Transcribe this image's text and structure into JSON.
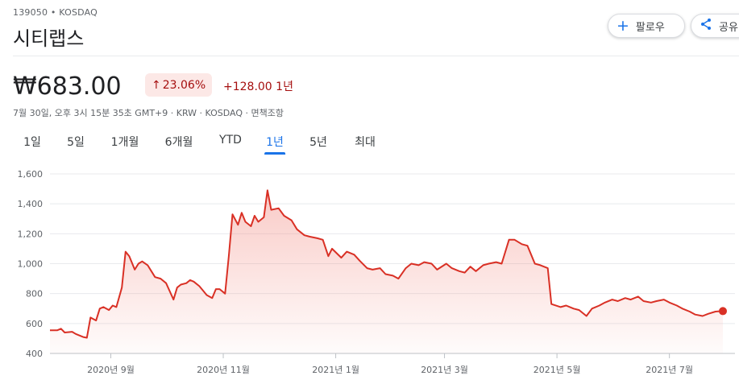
{
  "header": {
    "ticker": "139050 • KOSDAQ",
    "name": "시티랩스",
    "follow_label": "팔로우",
    "share_label": "공유"
  },
  "quote": {
    "price": "₩683.00",
    "change_pct": "23.06%",
    "change_abs": "+128.00 1년",
    "meta": "7월 30일, 오후 3시 15분 35초 GMT+9 · KRW · KOSDAQ · 면책조항"
  },
  "tabs": [
    {
      "label": "1일"
    },
    {
      "label": "5일"
    },
    {
      "label": "1개월"
    },
    {
      "label": "6개월"
    },
    {
      "label": "YTD"
    },
    {
      "label": "1년",
      "active": true
    },
    {
      "label": "5년"
    },
    {
      "label": "최대"
    }
  ],
  "colors": {
    "accent": "#1a73e8",
    "negative_text": "#a50e0e",
    "line": "#d93025",
    "badge_bg": "#fce8e6"
  },
  "icons": {
    "follow": "plus-icon",
    "share": "share-icon",
    "change": "arrow-up-icon"
  },
  "chart_data": {
    "type": "area",
    "ylim": [
      400,
      1600
    ],
    "yticks": [
      400,
      600,
      800,
      1000,
      1200,
      1400,
      1600
    ],
    "xticks": [
      "2020년 9월",
      "2020년 11월",
      "2021년 1월",
      "2021년 3월",
      "2021년 5월",
      "2021년 7월"
    ],
    "x_start": "2020-07-30",
    "x_end": "2021-07-30",
    "series": [
      {
        "values": [
          [
            "2020-07-30",
            555
          ],
          [
            "2020-08-03",
            555
          ],
          [
            "2020-08-05",
            565
          ],
          [
            "2020-08-07",
            540
          ],
          [
            "2020-08-11",
            545
          ],
          [
            "2020-08-13",
            530
          ],
          [
            "2020-08-17",
            510
          ],
          [
            "2020-08-19",
            505
          ],
          [
            "2020-08-21",
            640
          ],
          [
            "2020-08-24",
            620
          ],
          [
            "2020-08-26",
            700
          ],
          [
            "2020-08-28",
            710
          ],
          [
            "2020-08-31",
            690
          ],
          [
            "2020-09-02",
            720
          ],
          [
            "2020-09-04",
            710
          ],
          [
            "2020-09-07",
            840
          ],
          [
            "2020-09-09",
            1080
          ],
          [
            "2020-09-11",
            1050
          ],
          [
            "2020-09-14",
            960
          ],
          [
            "2020-09-16",
            1000
          ],
          [
            "2020-09-18",
            1015
          ],
          [
            "2020-09-21",
            990
          ],
          [
            "2020-09-23",
            950
          ],
          [
            "2020-09-25",
            910
          ],
          [
            "2020-09-28",
            900
          ],
          [
            "2020-10-01",
            870
          ],
          [
            "2020-10-05",
            760
          ],
          [
            "2020-10-07",
            840
          ],
          [
            "2020-10-09",
            860
          ],
          [
            "2020-10-12",
            870
          ],
          [
            "2020-10-14",
            890
          ],
          [
            "2020-10-16",
            880
          ],
          [
            "2020-10-19",
            850
          ],
          [
            "2020-10-21",
            820
          ],
          [
            "2020-10-23",
            790
          ],
          [
            "2020-10-26",
            770
          ],
          [
            "2020-10-28",
            830
          ],
          [
            "2020-10-30",
            830
          ],
          [
            "2020-11-02",
            800
          ],
          [
            "2020-11-04",
            1050
          ],
          [
            "2020-11-06",
            1330
          ],
          [
            "2020-11-09",
            1260
          ],
          [
            "2020-11-11",
            1340
          ],
          [
            "2020-11-13",
            1280
          ],
          [
            "2020-11-16",
            1250
          ],
          [
            "2020-11-18",
            1320
          ],
          [
            "2020-11-20",
            1280
          ],
          [
            "2020-11-23",
            1310
          ],
          [
            "2020-11-25",
            1490
          ],
          [
            "2020-11-27",
            1360
          ],
          [
            "2020-12-01",
            1370
          ],
          [
            "2020-12-04",
            1320
          ],
          [
            "2020-12-08",
            1290
          ],
          [
            "2020-12-11",
            1230
          ],
          [
            "2020-12-15",
            1190
          ],
          [
            "2020-12-18",
            1180
          ],
          [
            "2020-12-22",
            1170
          ],
          [
            "2020-12-25",
            1160
          ],
          [
            "2020-12-28",
            1050
          ],
          [
            "2020-12-30",
            1100
          ],
          [
            "2021-01-04",
            1040
          ],
          [
            "2021-01-07",
            1080
          ],
          [
            "2021-01-11",
            1060
          ],
          [
            "2021-01-14",
            1020
          ],
          [
            "2021-01-18",
            970
          ],
          [
            "2021-01-21",
            960
          ],
          [
            "2021-01-25",
            970
          ],
          [
            "2021-01-28",
            930
          ],
          [
            "2021-02-01",
            920
          ],
          [
            "2021-02-04",
            900
          ],
          [
            "2021-02-08",
            970
          ],
          [
            "2021-02-11",
            1000
          ],
          [
            "2021-02-15",
            990
          ],
          [
            "2021-02-18",
            1010
          ],
          [
            "2021-02-22",
            1000
          ],
          [
            "2021-02-25",
            960
          ],
          [
            "2021-03-02",
            1000
          ],
          [
            "2021-03-05",
            970
          ],
          [
            "2021-03-09",
            950
          ],
          [
            "2021-03-12",
            940
          ],
          [
            "2021-03-15",
            980
          ],
          [
            "2021-03-18",
            950
          ],
          [
            "2021-03-22",
            990
          ],
          [
            "2021-03-25",
            1000
          ],
          [
            "2021-03-29",
            1010
          ],
          [
            "2021-04-01",
            1000
          ],
          [
            "2021-04-05",
            1160
          ],
          [
            "2021-04-08",
            1160
          ],
          [
            "2021-04-12",
            1130
          ],
          [
            "2021-04-15",
            1120
          ],
          [
            "2021-04-19",
            1000
          ],
          [
            "2021-04-22",
            990
          ],
          [
            "2021-04-26",
            970
          ],
          [
            "2021-04-28",
            730
          ],
          [
            "2021-05-03",
            710
          ],
          [
            "2021-05-06",
            720
          ],
          [
            "2021-05-10",
            700
          ],
          [
            "2021-05-13",
            690
          ],
          [
            "2021-05-17",
            650
          ],
          [
            "2021-05-20",
            700
          ],
          [
            "2021-05-24",
            720
          ],
          [
            "2021-05-27",
            740
          ],
          [
            "2021-05-31",
            760
          ],
          [
            "2021-06-03",
            750
          ],
          [
            "2021-06-07",
            770
          ],
          [
            "2021-06-10",
            760
          ],
          [
            "2021-06-14",
            780
          ],
          [
            "2021-06-17",
            750
          ],
          [
            "2021-06-21",
            740
          ],
          [
            "2021-06-24",
            750
          ],
          [
            "2021-06-28",
            760
          ],
          [
            "2021-07-01",
            740
          ],
          [
            "2021-07-05",
            720
          ],
          [
            "2021-07-08",
            700
          ],
          [
            "2021-07-12",
            680
          ],
          [
            "2021-07-15",
            660
          ],
          [
            "2021-07-19",
            650
          ],
          [
            "2021-07-22",
            665
          ],
          [
            "2021-07-26",
            680
          ],
          [
            "2021-07-30",
            683
          ]
        ]
      }
    ]
  }
}
